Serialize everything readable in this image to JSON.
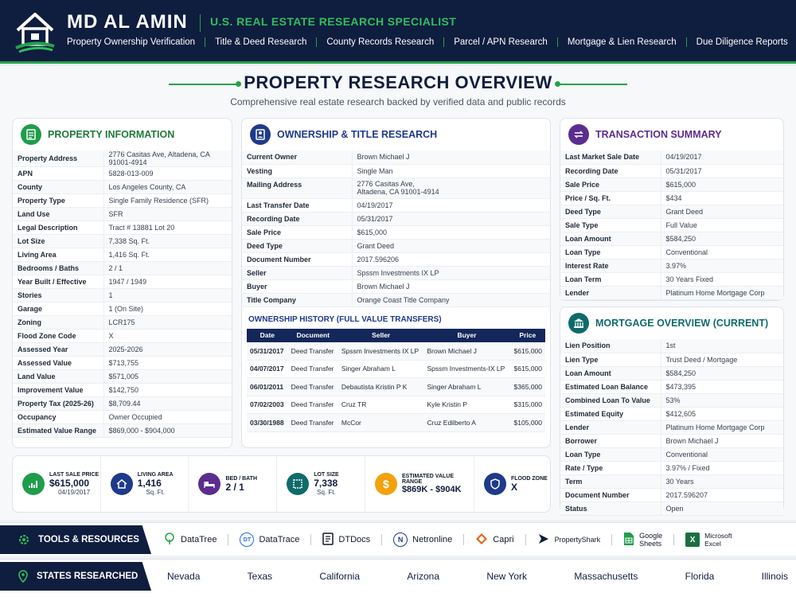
{
  "header": {
    "brand": "MD AL AMIN",
    "tagline": "U.S. REAL ESTATE RESEARCH SPECIALIST",
    "nav": [
      "Property Ownership Verification",
      "Title & Deed Research",
      "County Records Research",
      "Parcel / APN Research",
      "Mortgage & Lien Research",
      "Due Diligence Reports"
    ]
  },
  "page": {
    "title": "PROPERTY RESEARCH OVERVIEW",
    "subtitle": "Comprehensive real estate research backed by verified data and public records"
  },
  "property_info": {
    "title": "PROPERTY INFORMATION",
    "rows": [
      [
        "Property Address",
        "2776 Casitas Ave, Altadena, CA 91001-4914"
      ],
      [
        "APN",
        "5828-013-009"
      ],
      [
        "County",
        "Los Angeles County, CA"
      ],
      [
        "Property Type",
        "Single Family Residence (SFR)"
      ],
      [
        "Land Use",
        "SFR"
      ],
      [
        "Legal Description",
        "Tract # 13881 Lot 20"
      ],
      [
        "Lot Size",
        "7,338 Sq. Ft."
      ],
      [
        "Living Area",
        "1,416 Sq. Ft."
      ],
      [
        "Bedrooms / Baths",
        "2 / 1"
      ],
      [
        "Year Built / Effective",
        "1947 / 1949"
      ],
      [
        "Stories",
        "1"
      ],
      [
        "Garage",
        "1 (On Site)"
      ],
      [
        "Zoning",
        "LCR175"
      ],
      [
        "Flood Zone Code",
        "X"
      ],
      [
        "Assessed Year",
        "2025-2026"
      ],
      [
        "Assessed Value",
        "$713,755"
      ],
      [
        "Land Value",
        "$571,005"
      ],
      [
        "Improvement Value",
        "$142,750"
      ],
      [
        "Property Tax (2025-26)",
        "$8,709.44"
      ],
      [
        "Occupancy",
        "Owner Occupied"
      ],
      [
        "Estimated Value Range",
        "$869,000 - $904,000"
      ]
    ]
  },
  "ownership": {
    "title": "OWNERSHIP & TITLE RESEARCH",
    "rows": [
      [
        "Current Owner",
        "Brown Michael J"
      ],
      [
        "Vesting",
        "Single Man"
      ],
      [
        "Mailing Address",
        "2776 Casitas Ave,",
        "Altadena, CA 91001-4914"
      ],
      [
        "Last Transfer Date",
        "04/19/2017"
      ],
      [
        "Recording Date",
        "05/31/2017"
      ],
      [
        "Sale Price",
        "$615,000"
      ],
      [
        "Deed Type",
        "Grant Deed"
      ],
      [
        "Document Number",
        "2017.596206"
      ],
      [
        "Seller",
        "Spssm Investments IX LP"
      ],
      [
        "Buyer",
        "Brown Michael J"
      ],
      [
        "Title Company",
        "Orange Coast Title Company"
      ]
    ],
    "history_title": "OWNERSHIP HISTORY (FULL VALUE TRANSFERS)",
    "history_headers": [
      "Date",
      "Document",
      "Seller",
      "Buyer",
      "Price"
    ],
    "history": [
      [
        "05/31/2017",
        "Deed Transfer",
        "Spssm Investments IX LP",
        "Brown Michael J",
        "$615,000"
      ],
      [
        "04/07/2017",
        "Deed Transfer",
        "Singer Abraham L",
        "Spssm Investments-IX LP",
        "$615,000"
      ],
      [
        "06/01/2011",
        "Deed Transfer",
        "Debautista Kristin P K",
        "Singer Abraham L",
        "$365,000"
      ],
      [
        "07/02/2003",
        "Deed Transfer",
        "Cruz TR",
        "Kyle Kristin P",
        "$315,000"
      ],
      [
        "03/30/1988",
        "Deed Transfer",
        "McCor",
        "Cruz Edilberto A",
        "$105,000"
      ]
    ]
  },
  "transaction": {
    "title": "TRANSACTION SUMMARY",
    "rows": [
      [
        "Last Market Sale Date",
        "04/19/2017"
      ],
      [
        "Recording Date",
        "05/31/2017"
      ],
      [
        "Sale Price",
        "$615,000"
      ],
      [
        "Price / Sq. Ft.",
        "$434"
      ],
      [
        "Deed Type",
        "Grant Deed"
      ],
      [
        "Sale Type",
        "Full Value"
      ],
      [
        "Loan Amount",
        "$584,250"
      ],
      [
        "Loan Type",
        "Conventional"
      ],
      [
        "Interest Rate",
        "3.97%"
      ],
      [
        "Loan Term",
        "30 Years Fixed"
      ],
      [
        "Lender",
        "Platinum Home Mortgage Corp"
      ]
    ]
  },
  "mortgage": {
    "title": "MORTGAGE OVERVIEW (CURRENT)",
    "rows": [
      [
        "Lien Position",
        "1st"
      ],
      [
        "Lien Type",
        "Trust Deed / Mortgage"
      ],
      [
        "Loan Amount",
        "$584,250"
      ],
      [
        "Estimated Loan Balance",
        "$473,395"
      ],
      [
        "Combined Loan To Value",
        "53%"
      ],
      [
        "Estimated Equity",
        "$412,605"
      ],
      [
        "Lender",
        "Platinum Home Mortgage Corp"
      ],
      [
        "Borrower",
        "Brown Michael J"
      ],
      [
        "Loan Type",
        "Conventional"
      ],
      [
        "Rate / Type",
        "3.97% / Fixed"
      ],
      [
        "Term",
        "30 Years"
      ],
      [
        "Document Number",
        "2017.596207"
      ],
      [
        "Status",
        "Open"
      ]
    ]
  },
  "stats": [
    {
      "label": "LAST SALE PRICE",
      "value": "$615,000",
      "sub": "04/19/2017",
      "color": "#1f9d4a",
      "icon": "chart-icon"
    },
    {
      "label": "LIVING AREA",
      "value": "1,416",
      "sub": "Sq. Ft.",
      "color": "#1e3a8a",
      "icon": "house-icon"
    },
    {
      "label": "BED / BATH",
      "value": "2 / 1",
      "sub": "",
      "color": "#5b2d8e",
      "icon": "bed-icon"
    },
    {
      "label": "LOT SIZE",
      "value": "7,338",
      "sub": "Sq. Ft.",
      "color": "#0f6b6b",
      "icon": "lot-icon"
    },
    {
      "label": "ESTIMATED VALUE RANGE",
      "value": "$869K - $904K",
      "sub": "",
      "color": "#f2a20c",
      "icon": "dollar-icon"
    },
    {
      "label": "FLOOD ZONE",
      "value": "X",
      "sub": "",
      "color": "#1e3a8a",
      "icon": "shield-icon"
    }
  ],
  "tools": {
    "label": "TOOLS & RESOURCES",
    "items": [
      "DataTree",
      "DataTrace",
      "DTDocs",
      "Netronline",
      "Capri",
      "PropertyShark",
      "Google Sheets",
      "Microsoft Excel"
    ],
    "sheets_lines": [
      "Google",
      "Sheets"
    ],
    "excel_lines": [
      "Microsoft",
      "Excel"
    ]
  },
  "states": {
    "label": "STATES RESEARCHED",
    "items": [
      "Nevada",
      "Texas",
      "California",
      "Arizona",
      "New York",
      "Massachusetts",
      "Florida",
      "Illinois"
    ]
  },
  "colors": {
    "navy": "#0f1d3f",
    "green": "#22a34a",
    "purple": "#5b2d8e",
    "teal": "#0f6b6b",
    "blue": "#1e3a8a"
  }
}
